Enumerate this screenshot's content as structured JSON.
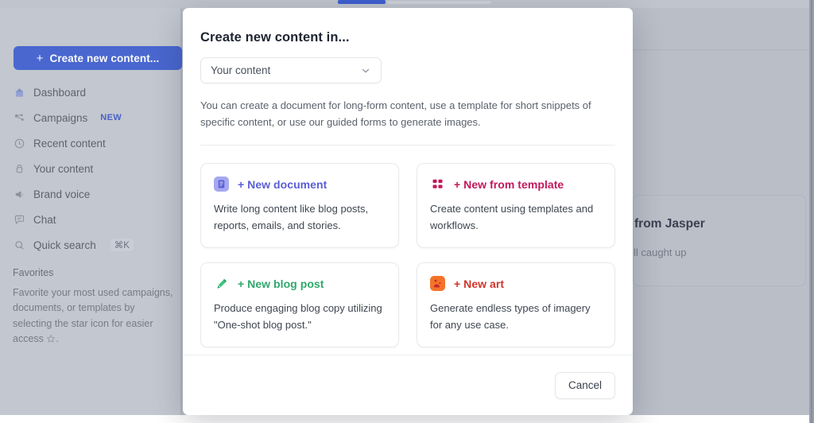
{
  "sidebar": {
    "create_button": {
      "plus": "+",
      "label": "Create new content..."
    },
    "items": [
      {
        "icon": "dashboard-icon",
        "label": "Dashboard",
        "badge": ""
      },
      {
        "icon": "campaigns-icon",
        "label": "Campaigns",
        "badge": "NEW"
      },
      {
        "icon": "clock-icon",
        "label": "Recent content",
        "badge": ""
      },
      {
        "icon": "user-content-icon",
        "label": "Your content",
        "badge": ""
      },
      {
        "icon": "megaphone-icon",
        "label": "Brand voice",
        "badge": ""
      },
      {
        "icon": "chat-icon",
        "label": "Chat",
        "badge": ""
      },
      {
        "icon": "search-icon",
        "label": "Quick search",
        "shortcut": "⌘K"
      }
    ],
    "favorites": {
      "title": "Favorites",
      "text": "Favorite your most used campaigns, documents, or templates by selecting the star icon for easier access"
    }
  },
  "background": {
    "card_title": "from Jasper",
    "card_subtitle": "ll caught up"
  },
  "modal": {
    "title": "Create new content in...",
    "select": {
      "value": "Your content",
      "icon": "chevron-down-icon"
    },
    "description": "You can create a document for long-form content, use a template for short snippets of specific content, or use our guided forms to generate images.",
    "cards": [
      {
        "icon": "document-icon",
        "icon_bg": "#a5a8f0",
        "icon_fg": "#5b5fd6",
        "title": "+ New document",
        "color": "#5b5fd6",
        "description": "Write long content like blog posts, reports, emails, and stories."
      },
      {
        "icon": "template-grid-icon",
        "icon_bg": "#ffffff",
        "icon_fg": "#c2185b",
        "title": "+ New from template",
        "color": "#c2185b",
        "description": "Create content using templates and workflows."
      },
      {
        "icon": "pencil-icon",
        "icon_bg": "#ffffff",
        "icon_fg": "#2fb573",
        "title": "+ New blog post",
        "color": "#2fa86b",
        "description": "Produce engaging blog copy utilizing \"One-shot blog post.\""
      },
      {
        "icon": "art-icon",
        "icon_bg": "#f4732a",
        "icon_fg": "#c62828",
        "title": "+ New art",
        "color": "#d2342a",
        "description": "Generate endless types of imagery for any use case."
      }
    ],
    "cancel_label": "Cancel"
  },
  "colors": {
    "primary_blue": "#3f5fd0",
    "badge_new": "#4a62c9",
    "overlay": "#b4b9c2"
  }
}
